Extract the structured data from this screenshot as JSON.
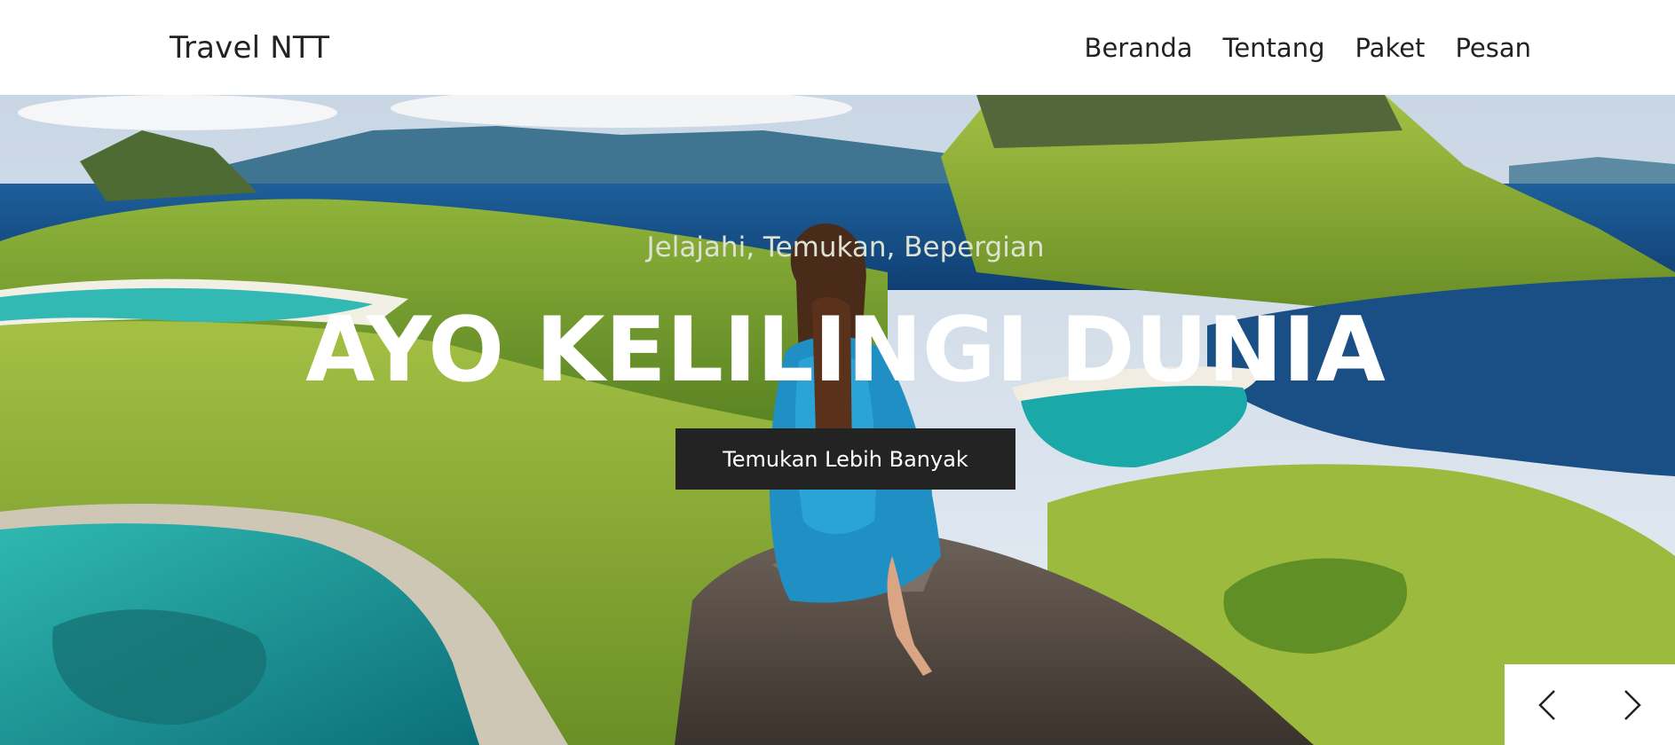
{
  "navbar": {
    "brand": "Travel NTT",
    "links": [
      {
        "label": "Beranda"
      },
      {
        "label": "Tentang"
      },
      {
        "label": "Paket"
      },
      {
        "label": "Pesan"
      }
    ]
  },
  "hero": {
    "tagline": "Jelajahi, Temukan, Bepergian",
    "title": "AYO KELILINGI DUNIA",
    "cta_label": "Temukan Lebih Banyak"
  },
  "slider": {
    "prev_icon": "chevron-left-icon",
    "next_icon": "chevron-right-icon"
  },
  "colors": {
    "navbar_bg": "#ffffff",
    "nav_text": "#222222",
    "cta_bg": "#232323",
    "cta_text": "#ffffff",
    "hero_title": "#ffffff",
    "hero_tagline": "#dde2d3"
  }
}
